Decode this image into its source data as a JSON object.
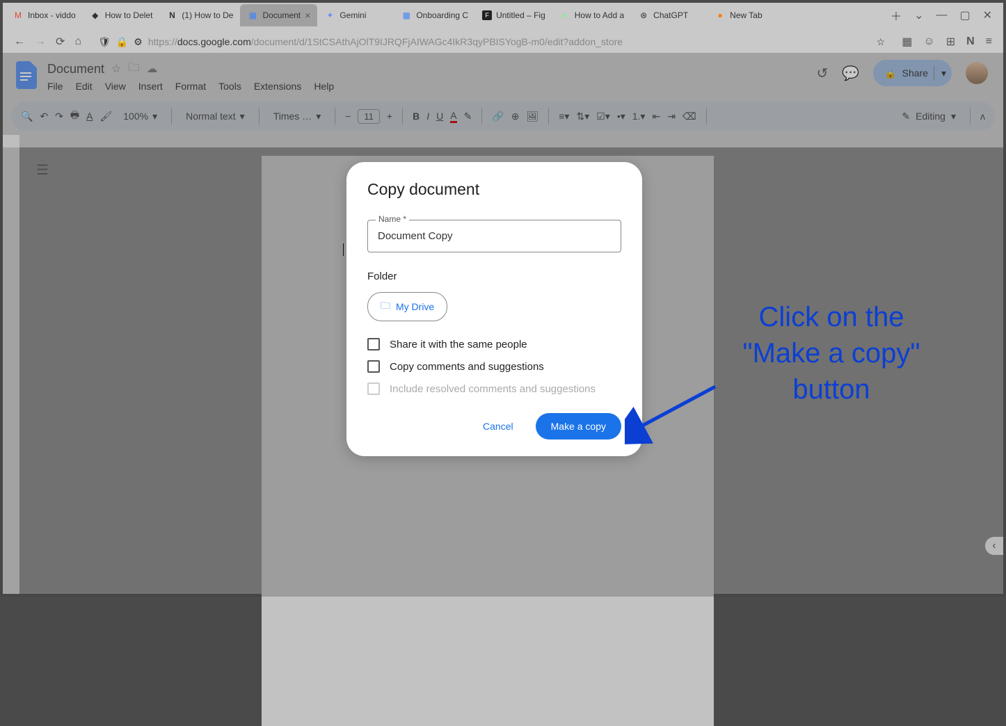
{
  "browser": {
    "tabs": [
      {
        "label": "Inbox - viddo",
        "icon": "M"
      },
      {
        "label": "How to Delet",
        "icon": "◆"
      },
      {
        "label": "(1) How to De",
        "icon": "N"
      },
      {
        "label": "Document",
        "icon": "≡",
        "active": true
      },
      {
        "label": "Gemini",
        "icon": "✦"
      },
      {
        "label": "Onboarding C",
        "icon": "≡"
      },
      {
        "label": "Untitled – Fig",
        "icon": "F"
      },
      {
        "label": "How to Add a",
        "icon": "●"
      },
      {
        "label": "ChatGPT",
        "icon": "⊛"
      },
      {
        "label": "New Tab",
        "icon": "🦊"
      }
    ],
    "url_prefix": "https://",
    "url_host": "docs.google.com",
    "url_path": "/document/d/1StCSAthAjOlT9IJRQFjAIWAGc4IkR3qyPBISYogB-m0/edit?addon_store"
  },
  "docs": {
    "title": "Document",
    "menus": [
      "File",
      "Edit",
      "View",
      "Insert",
      "Format",
      "Tools",
      "Extensions",
      "Help"
    ],
    "share_label": "Share"
  },
  "toolbar": {
    "zoom": "100%",
    "style": "Normal text",
    "font": "Times …",
    "font_size": "11",
    "editing_mode": "Editing"
  },
  "modal": {
    "title": "Copy document",
    "name_label": "Name *",
    "name_value": "Document Copy",
    "folder_label": "Folder",
    "folder_value": "My Drive",
    "check1": "Share it with the same people",
    "check2": "Copy comments and suggestions",
    "check3": "Include resolved comments and suggestions",
    "cancel": "Cancel",
    "confirm": "Make a copy"
  },
  "annotation": {
    "line1": "Click on the",
    "line2": "\"Make a copy\"",
    "line3": "button"
  }
}
